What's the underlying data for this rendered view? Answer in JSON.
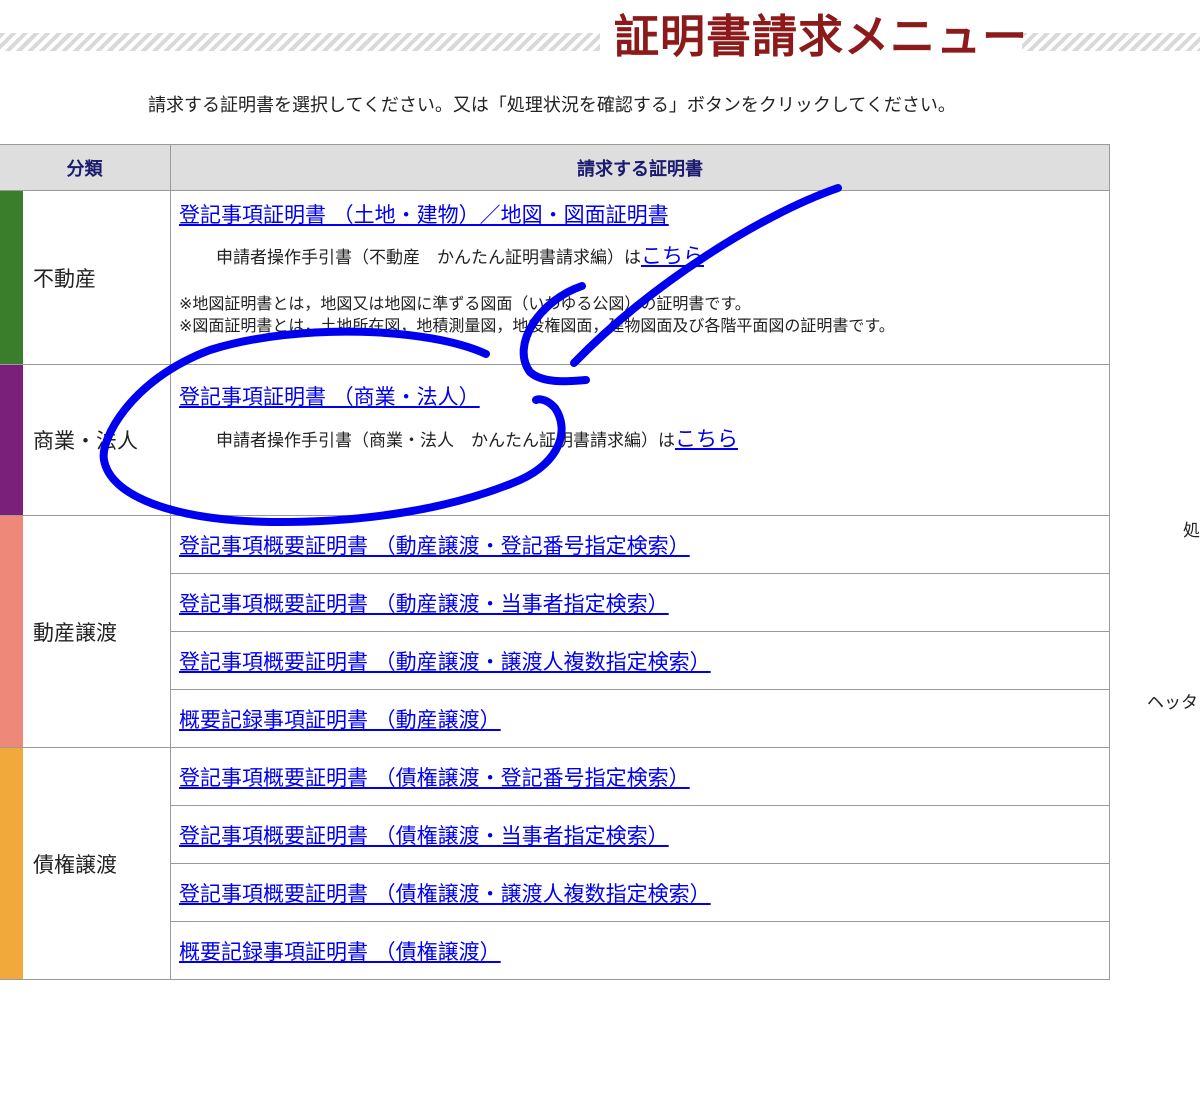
{
  "header": {
    "title": "証明書請求メニュー",
    "title_color": "#8c1a1a"
  },
  "instruction": "請求する証明書を選択してください。又は「処理状況を確認する」ボタンをクリックしてください。",
  "table": {
    "headers": {
      "category": "分類",
      "certificate": "請求する証明書"
    },
    "realestate": {
      "name": "不動産",
      "color": "#3a7d2a",
      "link": "登記事項証明書 （土地・建物）／地図・図面証明書",
      "guide_prefix": "申請者操作手引書（不動産　かんたん証明書請求編）は",
      "guide_link": "こちら",
      "note1": "※地図証明書とは，地図又は地図に準ずる図面（いわゆる公図）の証明書です。",
      "note2": "※図面証明書とは，土地所在図，地積測量図，地役権図面，建物図面及び各階平面図の証明書です。"
    },
    "corporate": {
      "name": "商業・法人",
      "color": "#7a1f7a",
      "link": "登記事項証明書 （商業・法人）",
      "guide_prefix": "申請者操作手引書（商業・法人　かんたん証明書請求編）は",
      "guide_link": "こちら"
    },
    "movable": {
      "name": "動産譲渡",
      "color": "#ee8878",
      "links": [
        "登記事項概要証明書 （動産譲渡・登記番号指定検索）",
        "登記事項概要証明書 （動産譲渡・当事者指定検索）",
        "登記事項概要証明書 （動産譲渡・譲渡人複数指定検索）",
        "概要記録事項証明書 （動産譲渡）"
      ]
    },
    "claims": {
      "name": "債権譲渡",
      "color": "#f2a93b",
      "links": [
        "登記事項概要証明書 （債権譲渡・登記番号指定検索）",
        "登記事項概要証明書 （債権譲渡・当事者指定検索）",
        "登記事項概要証明書 （債権譲渡・譲渡人複数指定検索）",
        "概要記録事項証明書 （債権譲渡）"
      ]
    }
  },
  "side": {
    "text1": "処",
    "text2": "ヘッタ"
  },
  "annotation": {
    "stroke_color": "#0000ee"
  }
}
